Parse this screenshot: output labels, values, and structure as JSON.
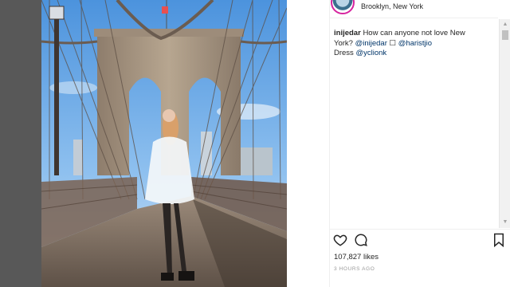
{
  "post": {
    "location": "Brooklyn, New York",
    "caption": {
      "username": "inijedar",
      "text_before": "How can anyone not love New York?",
      "mention_1": "@inijedar",
      "glyph": "☐",
      "mention_2": "@haristjio",
      "dress_label": "Dress",
      "mention_3": "@yclionk"
    },
    "likes": "107,827 likes",
    "timestamp": "3 HOURS AGO"
  },
  "icons": {
    "like": "heart-icon",
    "comment": "comment-icon",
    "save": "bookmark-icon",
    "scroll_up": "▲",
    "scroll_down": "▼"
  },
  "colors": {
    "sky": "#5b9fe0",
    "bridge_stone": "#a2907c",
    "text": "#262626",
    "mention": "#003569",
    "muted": "#999999"
  }
}
